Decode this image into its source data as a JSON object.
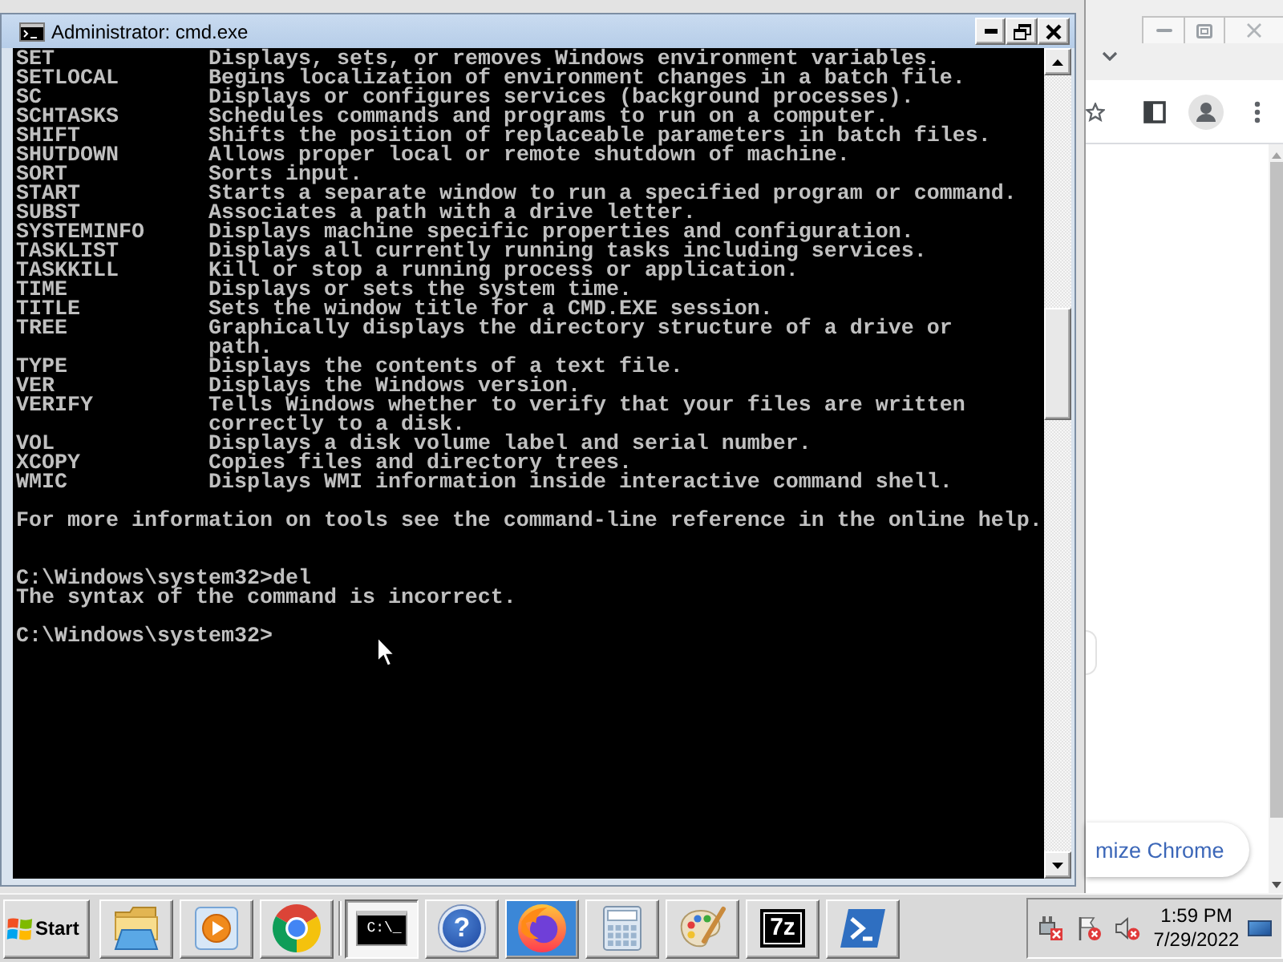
{
  "cmd_window": {
    "title": "Administrator: cmd.exe",
    "console": {
      "help_entries": [
        {
          "command": "SET",
          "lines": [
            "Displays, sets, or removes Windows environment variables."
          ]
        },
        {
          "command": "SETLOCAL",
          "lines": [
            "Begins localization of environment changes in a batch file."
          ]
        },
        {
          "command": "SC",
          "lines": [
            "Displays or configures services (background processes)."
          ]
        },
        {
          "command": "SCHTASKS",
          "lines": [
            "Schedules commands and programs to run on a computer."
          ]
        },
        {
          "command": "SHIFT",
          "lines": [
            "Shifts the position of replaceable parameters in batch files."
          ]
        },
        {
          "command": "SHUTDOWN",
          "lines": [
            "Allows proper local or remote shutdown of machine."
          ]
        },
        {
          "command": "SORT",
          "lines": [
            "Sorts input."
          ]
        },
        {
          "command": "START",
          "lines": [
            "Starts a separate window to run a specified program or command."
          ]
        },
        {
          "command": "SUBST",
          "lines": [
            "Associates a path with a drive letter."
          ]
        },
        {
          "command": "SYSTEMINFO",
          "lines": [
            "Displays machine specific properties and configuration."
          ]
        },
        {
          "command": "TASKLIST",
          "lines": [
            "Displays all currently running tasks including services."
          ]
        },
        {
          "command": "TASKKILL",
          "lines": [
            "Kill or stop a running process or application."
          ]
        },
        {
          "command": "TIME",
          "lines": [
            "Displays or sets the system time."
          ]
        },
        {
          "command": "TITLE",
          "lines": [
            "Sets the window title for a CMD.EXE session."
          ]
        },
        {
          "command": "TREE",
          "lines": [
            "Graphically displays the directory structure of a drive or",
            "path."
          ]
        },
        {
          "command": "TYPE",
          "lines": [
            "Displays the contents of a text file."
          ]
        },
        {
          "command": "VER",
          "lines": [
            "Displays the Windows version."
          ]
        },
        {
          "command": "VERIFY",
          "lines": [
            "Tells Windows whether to verify that your files are written",
            "correctly to a disk."
          ]
        },
        {
          "command": "VOL",
          "lines": [
            "Displays a disk volume label and serial number."
          ]
        },
        {
          "command": "XCOPY",
          "lines": [
            "Copies files and directory trees."
          ]
        },
        {
          "command": "WMIC",
          "lines": [
            "Displays WMI information inside interactive command shell."
          ]
        }
      ],
      "help_note": "For more information on tools see the command-line reference in the online help.",
      "transcript": [
        {
          "kind": "prompt",
          "prompt": "C:\\Windows\\system32>",
          "input": "del"
        },
        {
          "kind": "output",
          "text": "The syntax of the command is incorrect."
        },
        {
          "kind": "prompt",
          "prompt": "C:\\Windows\\system32>"
        }
      ]
    }
  },
  "browser": {
    "bottom_button": {
      "label": "mize Chrome"
    }
  },
  "taskbar": {
    "start": {
      "label": "Start"
    },
    "quick_launch": [
      {
        "kind": "folder",
        "selected": false,
        "highlighted": false
      },
      {
        "kind": "player",
        "selected": false,
        "highlighted": false
      },
      {
        "kind": "chrome",
        "selected": false,
        "highlighted": false
      }
    ],
    "programs": [
      {
        "kind": "terminal",
        "label": "C:\\_",
        "selected": true,
        "highlighted": false
      },
      {
        "kind": "help",
        "label": "?",
        "selected": false,
        "highlighted": false
      },
      {
        "kind": "firefox",
        "selected": false,
        "highlighted": true
      },
      {
        "kind": "calculator",
        "selected": false,
        "highlighted": false
      },
      {
        "kind": "paint",
        "selected": false,
        "highlighted": false
      },
      {
        "kind": "archive",
        "label": "7z",
        "selected": false,
        "highlighted": false
      },
      {
        "kind": "powershell",
        "selected": false,
        "highlighted": false
      }
    ],
    "clock": {
      "time": "1:59 PM",
      "date": "7/29/2022"
    }
  }
}
